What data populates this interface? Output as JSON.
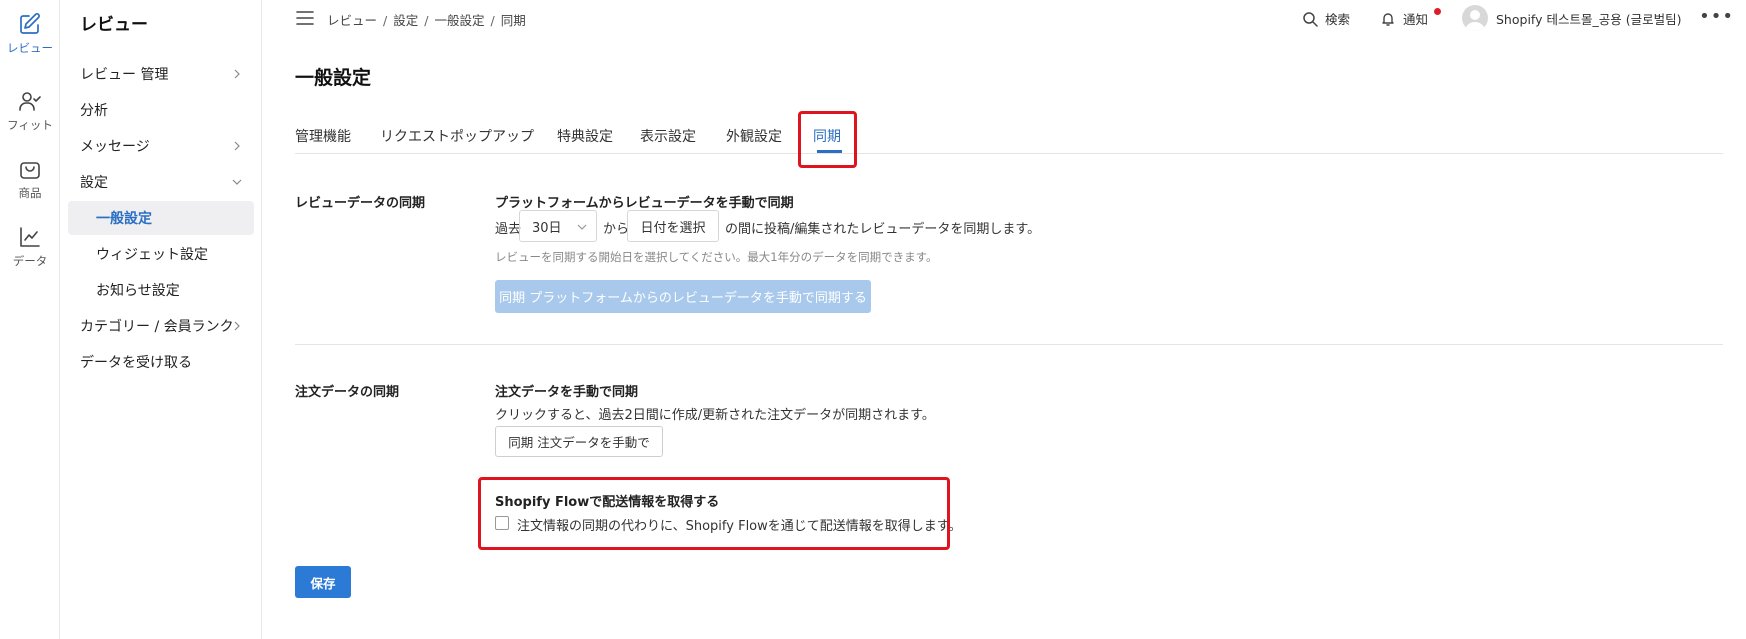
{
  "rail": {
    "items": [
      {
        "label": "レビュー",
        "icon": "edit-icon",
        "active": true
      },
      {
        "label": "フィット",
        "icon": "user-check-icon",
        "active": false
      },
      {
        "label": "商品",
        "icon": "shopping-bag-icon",
        "active": false
      },
      {
        "label": "データ",
        "icon": "line-chart-icon",
        "active": false
      }
    ]
  },
  "sidebar": {
    "title": "レビュー",
    "items": [
      {
        "label": "レビュー 管理"
      },
      {
        "label": "分析"
      },
      {
        "label": "メッセージ"
      },
      {
        "label": "設定"
      },
      {
        "label": "一般設定"
      },
      {
        "label": "ウィジェット設定"
      },
      {
        "label": "お知らせ設定"
      },
      {
        "label": "カテゴリー / 会員ランク"
      },
      {
        "label": "データを受け取る"
      }
    ]
  },
  "topbar": {
    "breadcrumb": [
      "レビュー",
      "設定",
      "一般設定",
      "同期"
    ],
    "search_label": "検索",
    "notify_label": "通知",
    "store_name": "Shopify 테스트몰_공용 (글로벌팀)"
  },
  "page": {
    "title": "一般設定",
    "tabs": [
      {
        "label": "管理機能"
      },
      {
        "label": "リクエストポップアップ"
      },
      {
        "label": "特典設定"
      },
      {
        "label": "表示設定"
      },
      {
        "label": "外観設定"
      },
      {
        "label": "同期"
      }
    ]
  },
  "review_sync": {
    "section_label": "レビューデータの同期",
    "title": "プラットフォームからレビューデータを手動で同期",
    "prefix": "過去",
    "period_value": "30日",
    "from_label": "から",
    "date_button": "日付を選択",
    "suffix": "の間に投稿/編集されたレビューデータを同期します。",
    "hint": "レビューを同期する開始日を選択してください。最大1年分のデータを同期できます。",
    "button": "同期 プラットフォームからのレビューデータを手動で同期する"
  },
  "order_sync": {
    "section_label": "注文データの同期",
    "title": "注文データを手動で同期",
    "description": "クリックすると、過去2日間に作成/更新された注文データが同期されます。",
    "button": "同期 注文データを手動で",
    "flow_title": "Shopify Flowで配送情報を取得する",
    "flow_checkbox_label": "注文情報の同期の代わりに、Shopify Flowを通じて配送情報を取得します。",
    "flow_checked": false
  },
  "save_button": "保存",
  "colors": {
    "accent": "#2b6fc4",
    "primary_button": "#2a7ad6",
    "disabled_button": "#a9c9ec",
    "highlight": "#e0141e",
    "notification_dot": "#d9202a"
  }
}
